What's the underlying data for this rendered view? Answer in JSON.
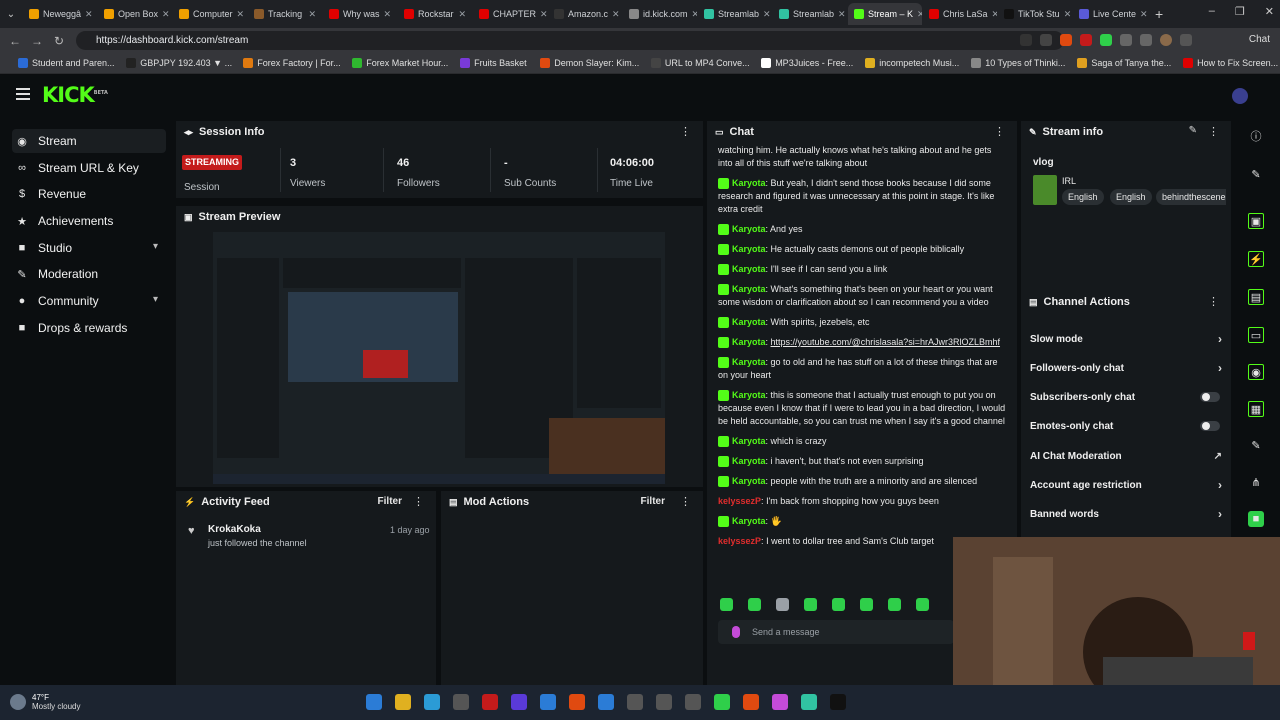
{
  "browser": {
    "tabs": [
      {
        "label": "Neweggâ",
        "color": "#f0a000"
      },
      {
        "label": "Open Box",
        "color": "#f0a000"
      },
      {
        "label": "Computer",
        "color": "#f0a000"
      },
      {
        "label": "Tracking",
        "color": "#8a5a2a"
      },
      {
        "label": "Why was",
        "color": "#e00000"
      },
      {
        "label": "Rockstar",
        "color": "#e00000"
      },
      {
        "label": "CHAPTER",
        "color": "#e00000"
      },
      {
        "label": "Amazon.c",
        "color": "#333333"
      },
      {
        "label": "id.kick.com",
        "color": "#888888"
      },
      {
        "label": "Streamlab",
        "color": "#31c3a2"
      },
      {
        "label": "Streamlab",
        "color": "#31c3a2"
      },
      {
        "label": "Stream – K",
        "color": "#53fc18",
        "active": true
      },
      {
        "label": "Chris LaSa",
        "color": "#e00000"
      },
      {
        "label": "TikTok Stu",
        "color": "#111111"
      },
      {
        "label": "Live Cente",
        "color": "#5a5ad8"
      }
    ],
    "url": "https://dashboard.kick.com/stream",
    "chat_button": "Chat",
    "bookmarks": [
      {
        "label": "Student and Paren...",
        "color": "#2b6bd6"
      },
      {
        "label": "GBPJPY 192.403 ▼ ...",
        "color": "#222222"
      },
      {
        "label": "Forex Factory | For...",
        "color": "#e07a10"
      },
      {
        "label": "Forex Market Hour...",
        "color": "#2fb82f"
      },
      {
        "label": "Fruits Basket",
        "color": "#7a3ad8"
      },
      {
        "label": "Demon Slayer: Kim...",
        "color": "#e04a10"
      },
      {
        "label": "URL to MP4 Conve...",
        "color": "#444444"
      },
      {
        "label": "MP3Juices - Free...",
        "color": "#ffffff"
      },
      {
        "label": "incompetech Musi...",
        "color": "#e0b020"
      },
      {
        "label": "10 Types of Thinki...",
        "color": "#888888"
      },
      {
        "label": "Saga of Tanya the...",
        "color": "#e0a020"
      },
      {
        "label": "How to Fix Screen...",
        "color": "#e00000"
      }
    ]
  },
  "app": {
    "logo": "KICK",
    "logo_beta": "BETA",
    "sidebar": [
      {
        "label": "Stream",
        "icon": "broadcast-icon",
        "glyph": "((·))",
        "active": true
      },
      {
        "label": "Stream URL & Key",
        "icon": "link-icon",
        "glyph": "∞"
      },
      {
        "label": "Revenue",
        "icon": "dollar-icon",
        "glyph": "$"
      },
      {
        "label": "Achievements",
        "icon": "trophy-icon",
        "glyph": "★"
      },
      {
        "label": "Studio",
        "icon": "studio-icon",
        "glyph": "■",
        "chevron": true
      },
      {
        "label": "Moderation",
        "icon": "shield-icon",
        "glyph": "✎"
      },
      {
        "label": "Community",
        "icon": "people-icon",
        "glyph": "●",
        "chevron": true
      },
      {
        "label": "Drops & rewards",
        "icon": "gift-icon",
        "glyph": "■"
      }
    ],
    "session": {
      "title": "Session Info",
      "badge": "STREAMING",
      "session_label": "Session",
      "stats": [
        {
          "value": "3",
          "label": "Viewers"
        },
        {
          "value": "46",
          "label": "Followers"
        },
        {
          "value": "-",
          "label": "Sub Counts"
        },
        {
          "value": "04:06:00",
          "label": "Time Live"
        }
      ]
    },
    "preview": {
      "title": "Stream Preview"
    },
    "activity": {
      "title": "Activity Feed",
      "filter": "Filter",
      "items": [
        {
          "user": "KrokaKoka",
          "text": "just followed the channel",
          "time": "1 day ago"
        }
      ]
    },
    "mod_actions": {
      "title": "Mod Actions",
      "filter": "Filter"
    },
    "chat": {
      "title": "Chat",
      "messages": [
        {
          "user": "",
          "text": "watching him. He actually knows what he's talking about and he gets into all of this stuff we're talking about"
        },
        {
          "user": "Karyota",
          "text": "But yeah, I didn't send those books because I did some research and figured it was unnecessary at this point in stage. It's like extra credit"
        },
        {
          "user": "Karyota",
          "text": "And yes"
        },
        {
          "user": "Karyota",
          "text": "He actually casts demons out of people biblically"
        },
        {
          "user": "Karyota",
          "text": "I'll see if I can send you a link"
        },
        {
          "user": "Karyota",
          "text": "What's something that's been on your heart or you want some wisdom or clarification about so I can recommend you a video"
        },
        {
          "user": "Karyota",
          "text": "With spirits, jezebels, etc"
        },
        {
          "user": "Karyota",
          "text": "",
          "link": "https://youtube.com/@chrislasala?si=hrAJwr3RlOZLBmhf"
        },
        {
          "user": "Karyota",
          "text": "go to old and he has stuff on a lot of these things that are on your heart"
        },
        {
          "user": "Karyota",
          "text": "this is someone that I actually trust enough to put you on because even I know that if I were to lead you in a bad direction, I would be held accountable, so you can trust me when I say it's a good channel"
        },
        {
          "user": "Karyota",
          "text": "which is crazy"
        },
        {
          "user": "Karyota",
          "text": "i haven't, but that's not even surprising"
        },
        {
          "user": "Karyota",
          "text": "people with the truth are a minority and are silenced"
        },
        {
          "user": "kelyssezP",
          "text": "I'm back from shopping how you guys been",
          "red": true
        },
        {
          "user": "Karyota",
          "text": "🖐"
        },
        {
          "user": "kelyssezP",
          "text": "I went to dollar tree and Sam's Club target",
          "red": true
        }
      ],
      "emote_colors": [
        "#2fcf4a",
        "#2fcf4a",
        "#9aa0a6",
        "#2fcf4a",
        "#2fcf4a",
        "#2fcf4a",
        "#2fcf4a",
        "#2fcf4a"
      ],
      "input_placeholder": "Send a message"
    },
    "stream_info": {
      "title": "Stream info",
      "stream_title": "vlog",
      "category": "IRL",
      "tags": [
        "English",
        "English",
        "behindthescenes"
      ]
    },
    "channel_actions": {
      "title": "Channel Actions",
      "rows": [
        {
          "label": "Slow mode",
          "control": "arrow"
        },
        {
          "label": "Followers-only chat",
          "control": "arrow"
        },
        {
          "label": "Subscribers-only chat",
          "control": "toggle"
        },
        {
          "label": "Emotes-only chat",
          "control": "toggle"
        },
        {
          "label": "AI Chat Moderation",
          "control": "external"
        },
        {
          "label": "Account age restriction",
          "control": "arrow"
        },
        {
          "label": "Banned words",
          "control": "arrow"
        }
      ]
    },
    "accent": "#53fc18"
  },
  "taskbar": {
    "temp": "47°F",
    "weather": "Mostly cloudy",
    "icons": [
      "#2b7cd6",
      "#e0b020",
      "#2b9bd6",
      "#555555",
      "#c41b1b",
      "#5a3ad8",
      "#2b7cd6",
      "#e04a10",
      "#2b7cd6",
      "#555555",
      "#555555",
      "#555555",
      "#2fcf4a",
      "#e04a10",
      "#c44bd8",
      "#31c3a2",
      "#111111"
    ]
  }
}
